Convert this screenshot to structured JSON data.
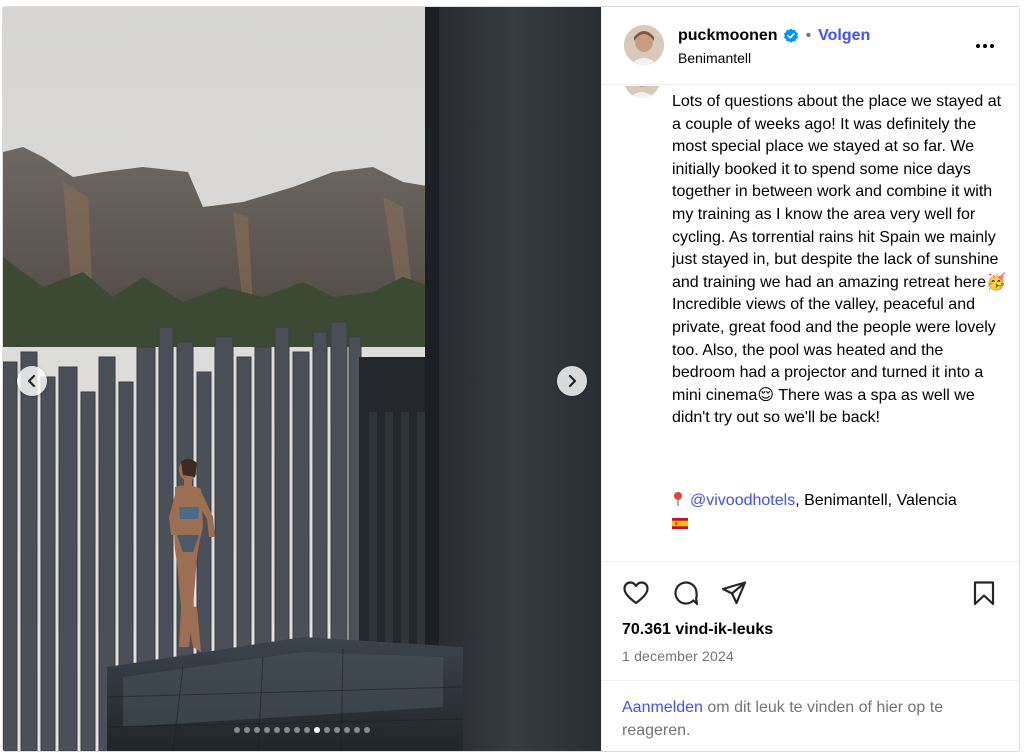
{
  "post": {
    "username": "puckmoonen",
    "follow_label": "Volgen",
    "separator": "•",
    "location": "Benimantell",
    "caption": "Lots of questions about the place we stayed at a couple of weeks ago! It was definitely the most special place we stayed at so far. We initially booked it to spend some nice days together in between work and combine it with my training as I know the area very well for cycling. As torrential rains hit Spain we mainly just stayed in, but despite the lack of sunshine and training we had an amazing retreat here🥳 Incredible views of the valley, peaceful and private, great food and the people were lovely too. Also, the pool was heated and the bedroom had a projector and turned it into a mini cinema😌 There was a spa as well we didn't try out so we'll be back!",
    "location_mention": "@vivoodhotels",
    "location_suffix": ", Benimantell, Valencia",
    "likes": "70.361 vind-ik-leuks",
    "date": "1 december 2024",
    "login_link": "Aanmelden",
    "login_suffix": " om dit leuk te vinden of hier op te reageren."
  },
  "carousel": {
    "dot_count": 14,
    "active_index": 8
  },
  "colors": {
    "link": "#4150f7",
    "verified": "#0095f6",
    "muted": "#737373"
  },
  "icons": {
    "header": [
      "verified-badge-icon",
      "more-options-icon"
    ],
    "actions": [
      "heart-icon",
      "comment-icon",
      "share-icon",
      "bookmark-icon"
    ],
    "nav": [
      "chevron-left-icon",
      "chevron-right-icon"
    ]
  }
}
